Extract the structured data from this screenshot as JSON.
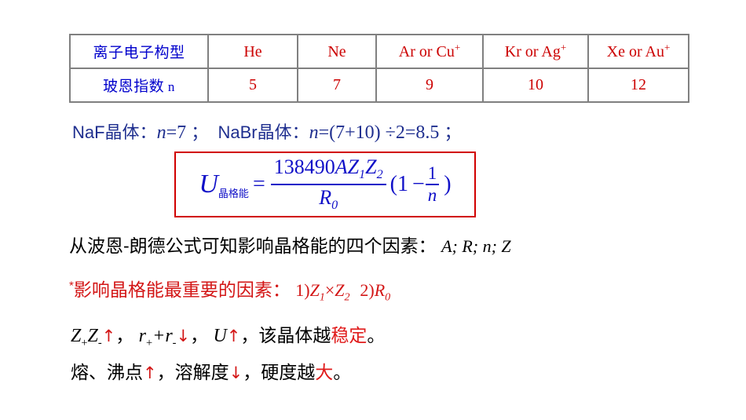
{
  "slide": {
    "table": {
      "rows": [
        {
          "header": "离子电子构型",
          "cells": [
            {
              "text": "He",
              "sup": ""
            },
            {
              "text": "Ne",
              "sup": ""
            },
            {
              "text": "Ar or Cu",
              "sup": "+"
            },
            {
              "text": "Kr or Ag",
              "sup": "+"
            },
            {
              "text": "Xe or Au",
              "sup": "+"
            }
          ]
        },
        {
          "header": "玻恩指数",
          "header_symbol": "n",
          "cells": [
            {
              "text": "5",
              "sup": ""
            },
            {
              "text": "7",
              "sup": ""
            },
            {
              "text": "9",
              "sup": ""
            },
            {
              "text": "10",
              "sup": ""
            },
            {
              "text": "12",
              "sup": ""
            }
          ]
        }
      ]
    },
    "examples_line": {
      "naf_label": "NaF晶体：",
      "naf_var": "n",
      "naf_value": "=7",
      "separator1": "；",
      "nabr_label": "NaBr晶体：",
      "nabr_var": "n",
      "nabr_value": "=(7+10) ÷2=8.5",
      "separator2": "；"
    },
    "formula": {
      "lhs_symbol": "U",
      "lhs_subscript": "晶格能",
      "equals": "=",
      "numerator_const": "138490",
      "numerator_vars": "AZ",
      "numerator_sub1": "1",
      "numerator_var2": "Z",
      "numerator_sub2": "2",
      "denominator": "R",
      "denominator_sub": "0",
      "paren_open": "(1",
      "minus": "−",
      "fraction_num": "1",
      "fraction_den": "n",
      "paren_close": ")",
      "border_color": "#D10000",
      "text_color": "#1010C8"
    },
    "factors_line": {
      "text": "从波恩-朗德公式可知影响晶格能的四个因素：",
      "symbols": "A; R; n; Z"
    },
    "key_factors_line": {
      "star": "*",
      "text": "影响晶格能最重要的因素：",
      "item1_prefix": "1)",
      "item1_z1": "Z",
      "item1_sub1": "1",
      "item1_times": "×",
      "item1_z2": "Z",
      "item1_sub2": "2",
      "item2_prefix": "2)",
      "item2_r": "R",
      "item2_sub": "0",
      "color": "#D31616"
    },
    "stability_line": {
      "z_plus": "Z",
      "z_plus_sub": "+",
      "z_minus": "Z",
      "z_minus_sub": "-",
      "arrow_up1": "↑",
      "comma1": "，",
      "r_plus": "r",
      "r_plus_sub": "+",
      "plus": "+",
      "r_minus": "r",
      "r_minus_sub": "-",
      "arrow_down1": "↓",
      "comma2": "，",
      "u_symbol": "U",
      "arrow_up2": "↑",
      "comma3": "，",
      "tail_black": "该晶体越",
      "tail_red": "稳定",
      "period": "。"
    },
    "melting_line": {
      "part1": "熔、沸点",
      "arrow_up": "↑",
      "comma1": "，",
      "part2": "溶解度",
      "arrow_down": "↓",
      "comma2": "，",
      "part3": "硬度越",
      "red_word": "大",
      "period": "。"
    }
  }
}
